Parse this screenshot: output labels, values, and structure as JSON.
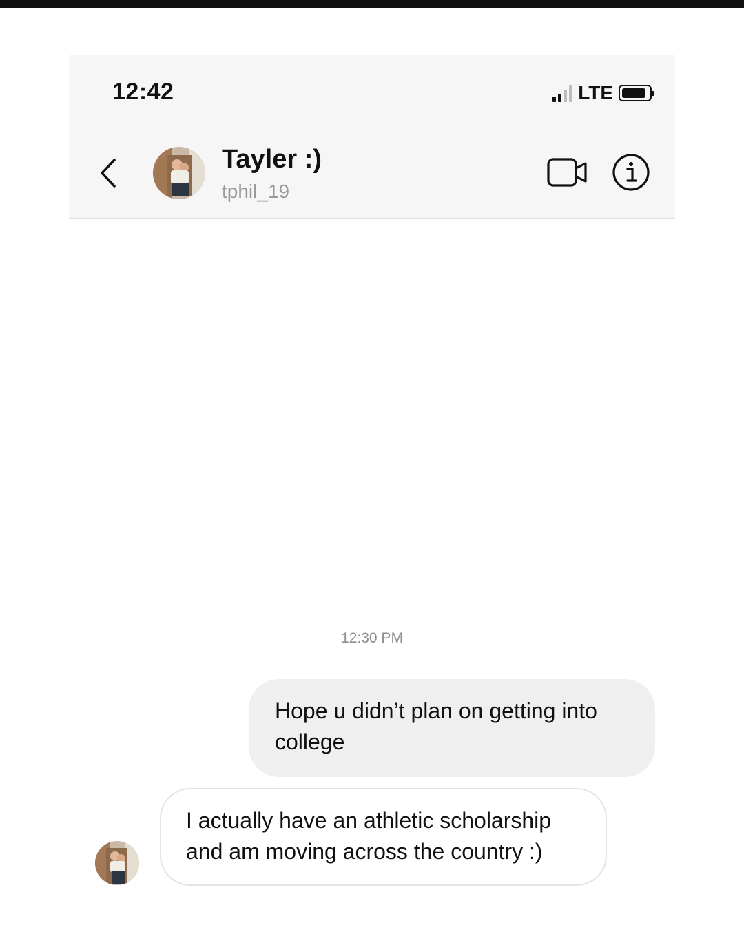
{
  "status_bar": {
    "time": "12:42",
    "network": "LTE"
  },
  "header": {
    "contact_name": "Tayler :)",
    "username": "tphil_19",
    "icons": {
      "back": "chevron-left-icon",
      "video": "video-camera-icon",
      "info": "info-icon"
    }
  },
  "conversation": {
    "timestamp": "12:30 PM",
    "messages": [
      {
        "direction": "sent",
        "text": "Hope u didn’t plan on getting into college"
      },
      {
        "direction": "received",
        "text": "I actually have an athletic scholarship and am moving across the country :)"
      }
    ]
  },
  "colors": {
    "sent_bubble": "#efefef",
    "received_border": "#e4e4e4",
    "header_bg": "#f6f6f6",
    "muted_text": "#9a9a9a"
  }
}
